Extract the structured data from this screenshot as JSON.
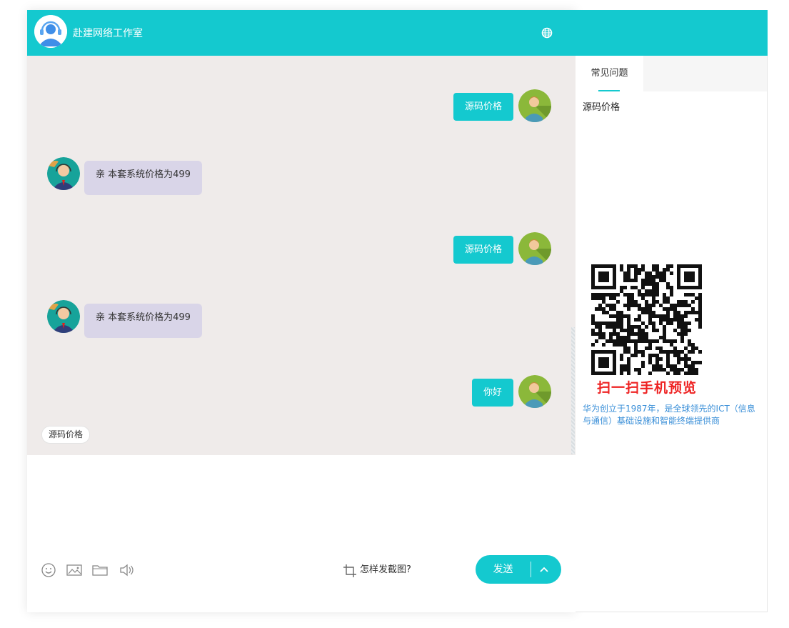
{
  "header": {
    "title": "赴建网络工作室"
  },
  "messages": [
    {
      "side": "right",
      "text": "源码价格"
    },
    {
      "side": "left",
      "text": "亲 本套系统价格为499"
    },
    {
      "side": "right",
      "text": "源码价格"
    },
    {
      "side": "left",
      "text": "亲 本套系统价格为499"
    },
    {
      "side": "right",
      "text": "你好"
    }
  ],
  "quick_reply": "源码价格",
  "toolbar": {
    "emoji_icon": "emoji-icon",
    "image_icon": "image-icon",
    "folder_icon": "folder-icon",
    "voice_icon": "speaker-icon",
    "screenshot_hint": "怎样发截图?",
    "send_label": "发送"
  },
  "side_panel": {
    "tab_label": "常见问题",
    "faq_items": [
      "源码价格"
    ],
    "qr_caption": "扫一扫手机预览",
    "intro": "华为创立于1987年，是全球领先的ICT（信息与通信）基础设施和智能终端提供商"
  },
  "colors": {
    "accent": "#14c9cf",
    "chat_bg": "#efebea",
    "agent_bubble": "#d9d5e8",
    "qr_caption": "#ee2222",
    "intro_text": "#3a8fd8"
  }
}
